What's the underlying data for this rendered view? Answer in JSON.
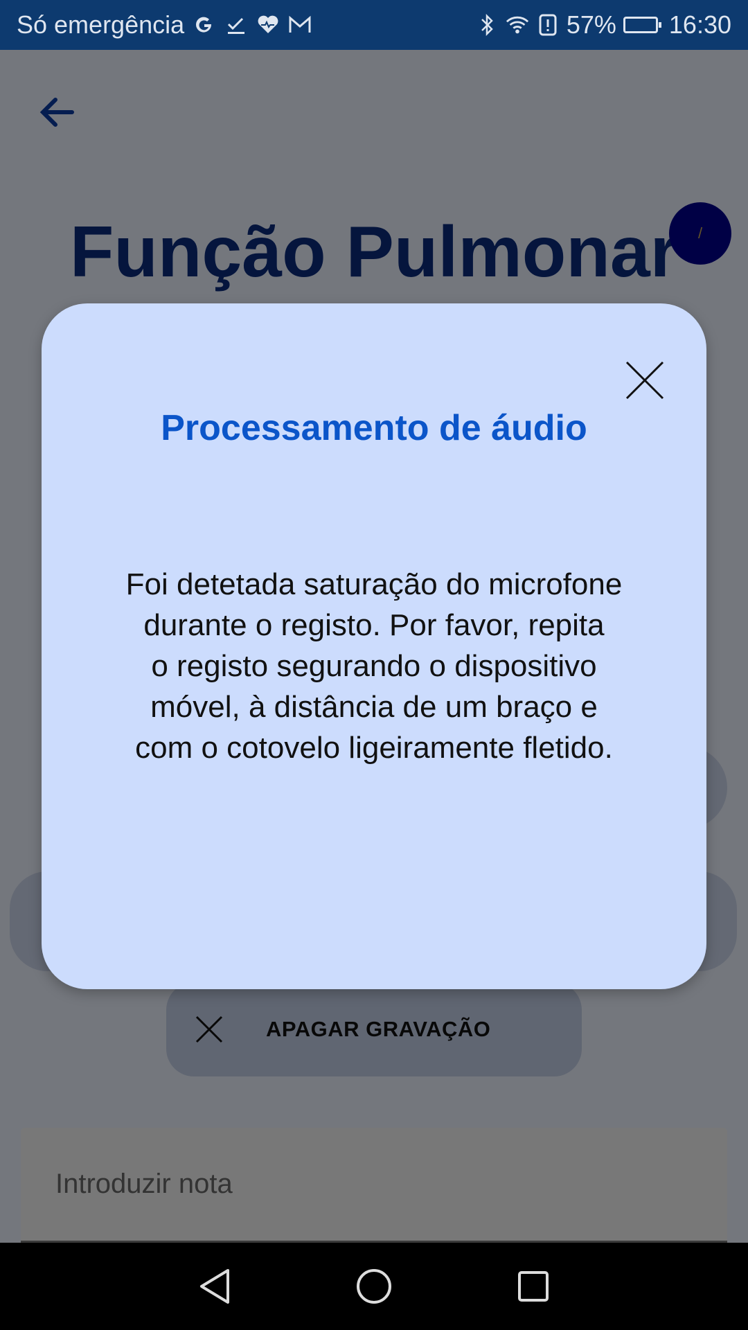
{
  "status_bar": {
    "carrier_text": "Só emergência",
    "icons_left": [
      "google-icon",
      "task-check-icon",
      "health-heart-icon",
      "gmail-icon"
    ],
    "icons_right": [
      "bluetooth-icon",
      "wifi-icon",
      "alert-icon",
      "battery-icon"
    ],
    "battery_percent": "57%",
    "time": "16:30"
  },
  "page": {
    "title": "Função Pulmonar",
    "info_badge": "/",
    "delete_recording_label": "APAGAR GRAVAÇÃO",
    "note_placeholder": "Introduzir nota"
  },
  "dialog": {
    "title": "Processamento de áudio",
    "message": "Foi detetada saturação do microfone\ndurante o registo. Por favor, repita\no registo segurando o dispositivo\nmóvel, à distância de um braço e\ncom o cotovelo ligeiramente fletido."
  },
  "colors": {
    "status_bar_bg": "#0d3a6f",
    "title_blue": "#0a2a7a",
    "dialog_bg": "#ccdcfd",
    "dialog_title": "#0b55c9",
    "info_badge_bg": "#00008b"
  }
}
